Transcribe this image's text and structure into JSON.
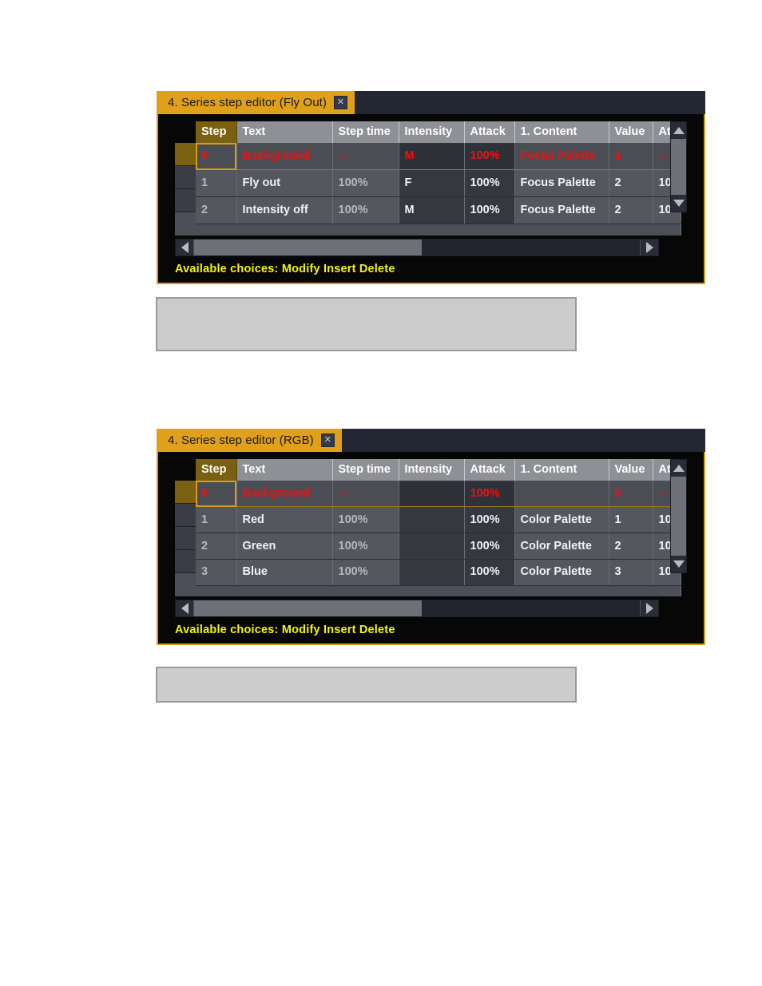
{
  "windows": [
    {
      "title": "4. Series step editor (Fly Out)",
      "close_icon": "close-icon",
      "close_glyph": "✕",
      "columns": [
        "Step",
        "Text",
        "Step time",
        "Intensity",
        "Attack",
        "1. Content",
        "Value",
        "At"
      ],
      "rows": [
        {
          "step": "0",
          "text": "Background",
          "step_time": "---",
          "intensity": "M",
          "attack": "100%",
          "content": "Focus Palette",
          "value": "1",
          "at": "---",
          "selected": true
        },
        {
          "step": "1",
          "text": "Fly out",
          "step_time": "100%",
          "intensity": "F",
          "attack": "100%",
          "content": "Focus Palette",
          "value": "2",
          "at": "10",
          "selected": false
        },
        {
          "step": "2",
          "text": "Intensity off",
          "step_time": "100%",
          "intensity": "M",
          "attack": "100%",
          "content": "Focus Palette",
          "value": "2",
          "at": "10",
          "selected": false
        }
      ],
      "hint": "Available choices: Modify Insert Delete",
      "scroll": {
        "h_thumb_percent": 51,
        "up_icon": "scroll-up-icon",
        "down_icon": "scroll-down-icon",
        "left_icon": "scroll-left-icon",
        "right_icon": "scroll-right-icon"
      }
    },
    {
      "title": "4. Series step editor (RGB)",
      "close_icon": "close-icon",
      "close_glyph": "✕",
      "columns": [
        "Step",
        "Text",
        "Step time",
        "Intensity",
        "Attack",
        "1. Content",
        "Value",
        "At"
      ],
      "rows": [
        {
          "step": "0",
          "text": "Background",
          "step_time": "---",
          "intensity": "",
          "attack": "100%",
          "content": "",
          "value": "0",
          "at": "---",
          "selected": true
        },
        {
          "step": "1",
          "text": "Red",
          "step_time": "100%",
          "intensity": "",
          "attack": "100%",
          "content": "Color Palette",
          "value": "1",
          "at": "10",
          "selected": false
        },
        {
          "step": "2",
          "text": "Green",
          "step_time": "100%",
          "intensity": "",
          "attack": "100%",
          "content": "Color Palette",
          "value": "2",
          "at": "10",
          "selected": false
        },
        {
          "step": "3",
          "text": "Blue",
          "step_time": "100%",
          "intensity": "",
          "attack": "100%",
          "content": "Color Palette",
          "value": "3",
          "at": "10",
          "selected": false
        }
      ],
      "hint": "Available choices: Modify Insert Delete",
      "scroll": {
        "h_thumb_percent": 51,
        "up_icon": "scroll-up-icon",
        "down_icon": "scroll-down-icon",
        "left_icon": "scroll-left-icon",
        "right_icon": "scroll-right-icon"
      }
    }
  ],
  "caption_boxes": [
    {
      "text": ""
    },
    {
      "text": ""
    }
  ],
  "colors": {
    "accent_gold": "#d79c16",
    "tab_gold": "#e0a01c",
    "selected_red": "#f01010",
    "hint_yellow": "#f4f411",
    "header_grey": "#8e9096",
    "cell_grey": "#55575f",
    "window_dark": "#070707"
  }
}
